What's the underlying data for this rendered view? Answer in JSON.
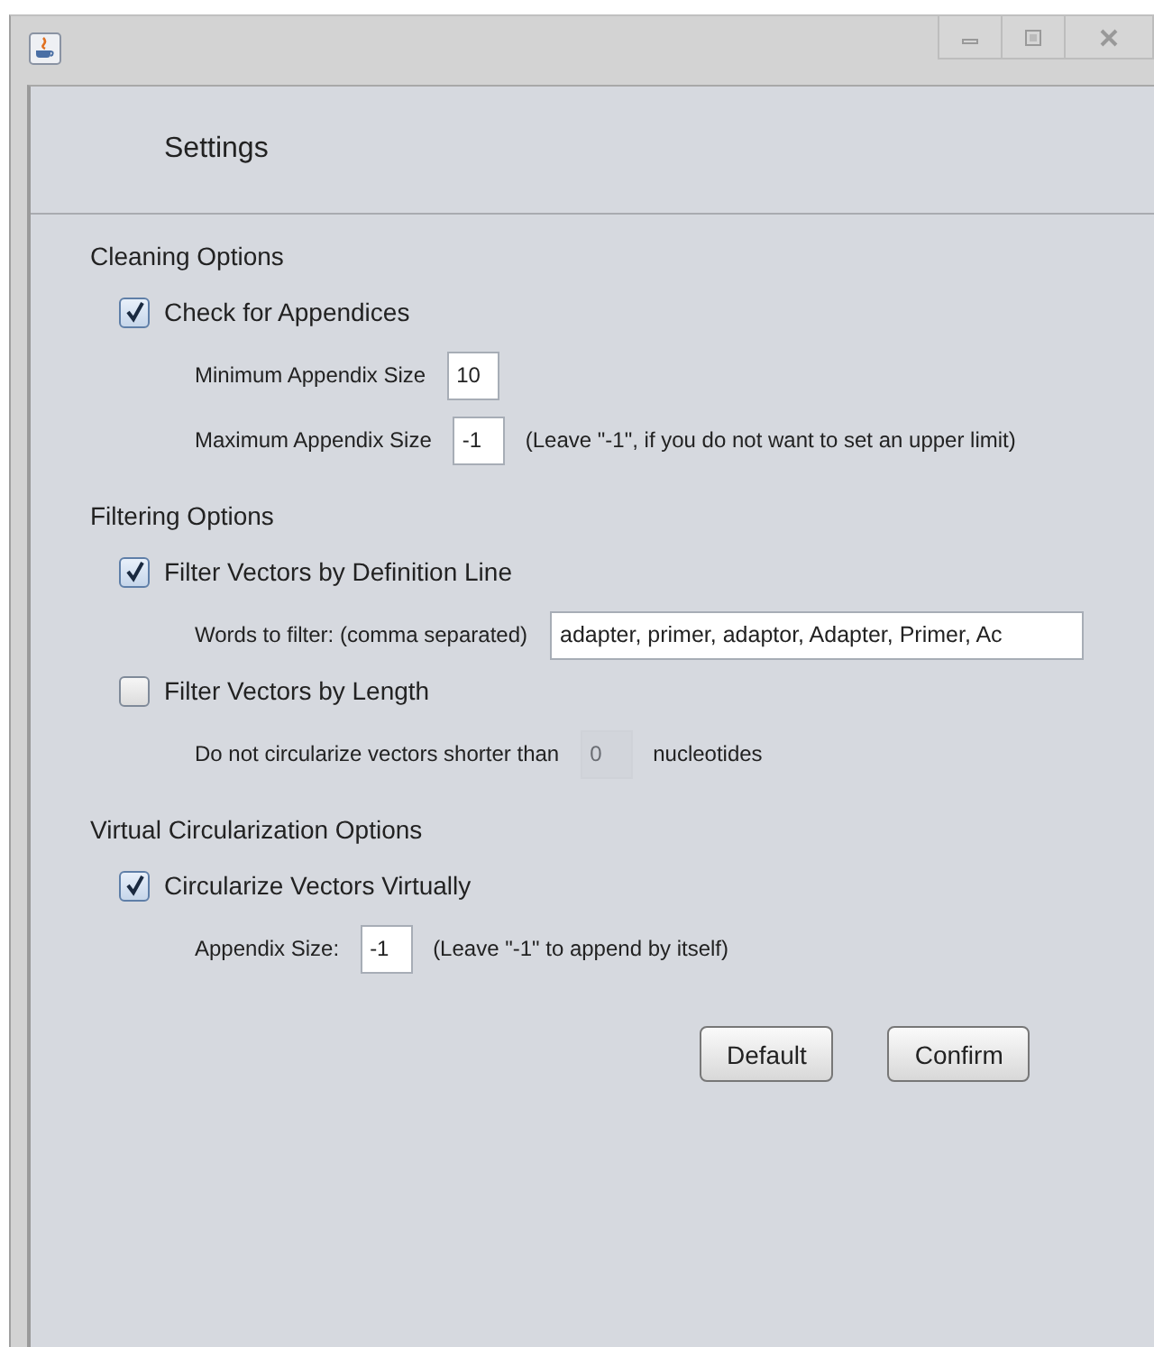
{
  "window": {
    "title": "Settings"
  },
  "sections": [
    {
      "title": "Cleaning Options",
      "items": [
        {
          "kind": "checkbox",
          "label": "Check for Appendices",
          "checked": true
        },
        {
          "kind": "number_field",
          "label": "Minimum Appendix Size",
          "value": "10",
          "disabled": false
        },
        {
          "kind": "number_field",
          "label": "Maximum Appendix Size",
          "value": "-1",
          "disabled": false,
          "note": "(Leave \"-1\", if you do not want to set an upper limit)"
        }
      ]
    },
    {
      "title": "Filtering Options",
      "items": [
        {
          "kind": "checkbox",
          "label": "Filter Vectors by Definition Line",
          "checked": true
        },
        {
          "kind": "text_field",
          "label": "Words to filter: (comma separated)",
          "value": "adapter, primer, adaptor, Adapter, Primer, Ac",
          "disabled": false
        },
        {
          "kind": "checkbox",
          "label": "Filter Vectors by Length",
          "checked": false
        },
        {
          "kind": "number_field",
          "label": "Do not circularize vectors shorter than",
          "value": "0",
          "disabled": true,
          "note": "nucleotides"
        }
      ]
    },
    {
      "title": "Virtual Circularization Options",
      "items": [
        {
          "kind": "checkbox",
          "label": "Circularize Vectors Virtually",
          "checked": true
        },
        {
          "kind": "number_field",
          "label": "Appendix Size:",
          "value": "-1",
          "disabled": false,
          "note": "(Leave \"-1\" to append by itself)"
        }
      ]
    }
  ],
  "buttons": [
    "Default",
    "Confirm"
  ]
}
